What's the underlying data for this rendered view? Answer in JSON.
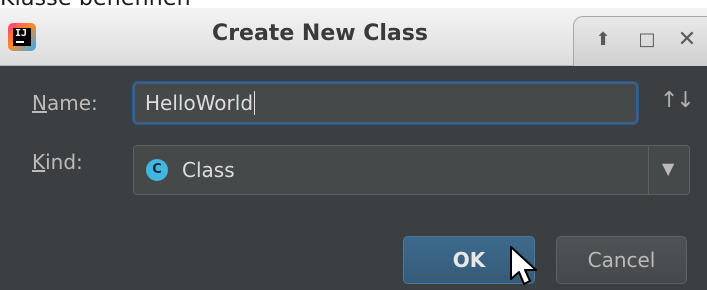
{
  "background_text": "Klasse benennen",
  "window": {
    "title": "Create New Class",
    "controls": {
      "up_icon": "arrow-up-icon",
      "maximize_icon": "maximize-icon",
      "close_icon": "close-icon"
    }
  },
  "form": {
    "name_label_mnemonic": "N",
    "name_label_rest": "ame:",
    "name_value": "HelloWorld",
    "sort_icon": "sort-arrows-icon",
    "kind_label_mnemonic": "K",
    "kind_label_rest": "ind:",
    "kind_icon_letter": "C",
    "kind_value": "Class"
  },
  "buttons": {
    "ok_label": "OK",
    "cancel_label": "Cancel"
  },
  "colors": {
    "dialog_bg": "#3c3f41",
    "accent": "#3d6185",
    "class_icon": "#40b6e0"
  }
}
